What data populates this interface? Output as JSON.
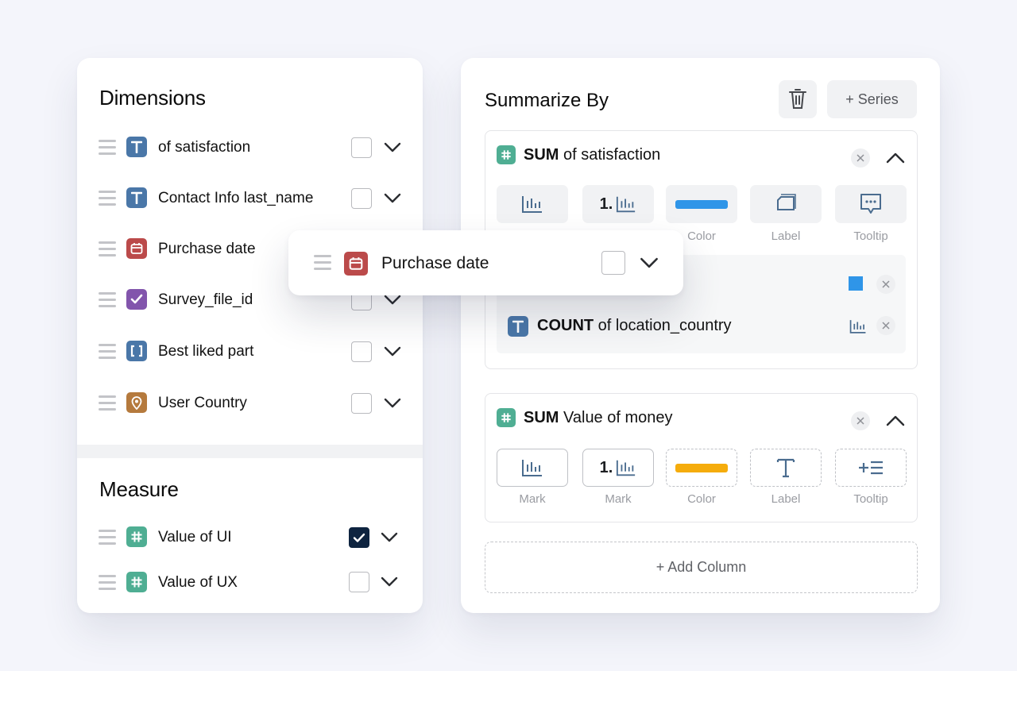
{
  "dimensions": {
    "title": "Dimensions",
    "items": [
      {
        "label": "of satisfaction",
        "type": "text",
        "checked": false
      },
      {
        "label": "Contact Info last_name",
        "type": "text",
        "checked": false
      },
      {
        "label": "Purchase date",
        "type": "date",
        "checked": false
      },
      {
        "label": "Survey_file_id",
        "type": "boolean",
        "checked": false
      },
      {
        "label": "Best liked part",
        "type": "array",
        "checked": false
      },
      {
        "label": "User Country",
        "type": "location",
        "checked": false
      }
    ]
  },
  "measure": {
    "title": "Measure",
    "items": [
      {
        "label": "Value of UI",
        "type": "number",
        "checked": true
      },
      {
        "label": "Value of UX",
        "type": "number",
        "checked": false
      }
    ]
  },
  "drag_item": {
    "label": "Purchase date",
    "type": "date",
    "checked": false
  },
  "summarize": {
    "title": "Summarize By",
    "trash_icon": "trash-icon",
    "series_button": "+ Series",
    "cards": [
      {
        "agg": "SUM",
        "name": "of satisfaction",
        "encodings": [
          {
            "label": "",
            "icon": "bar-chart-icon"
          },
          {
            "label": "",
            "icon": "numbered-bar-chart-icon"
          },
          {
            "label": "Color",
            "icon": "color-swatch",
            "color": "#2f95e8"
          },
          {
            "label": "Label",
            "icon": "label-stack-icon"
          },
          {
            "label": "Tooltip",
            "icon": "tooltip-icon"
          }
        ],
        "sub_items": [
          {
            "agg": "",
            "name": "",
            "color": "#2f95e8"
          },
          {
            "agg": "COUNT",
            "name": "of location_country",
            "icon": "bar-chart-icon"
          }
        ]
      },
      {
        "agg": "SUM",
        "name": "Value of money",
        "encodings": [
          {
            "label": "Mark",
            "icon": "bar-chart-icon"
          },
          {
            "label": "Mark",
            "icon": "numbered-bar-chart-icon"
          },
          {
            "label": "Color",
            "icon": "color-swatch",
            "color": "#f5ac0c"
          },
          {
            "label": "Label",
            "icon": "text-t-icon"
          },
          {
            "label": "Tooltip",
            "icon": "tooltip-lines-icon"
          }
        ]
      }
    ],
    "add_column": "+ Add Column"
  },
  "type_colors": {
    "text": "#4a77a8",
    "date": "#bb4a4a",
    "boolean": "#8255ac",
    "array": "#4a77a8",
    "location": "#b57a3d",
    "number": "#4fae93"
  }
}
